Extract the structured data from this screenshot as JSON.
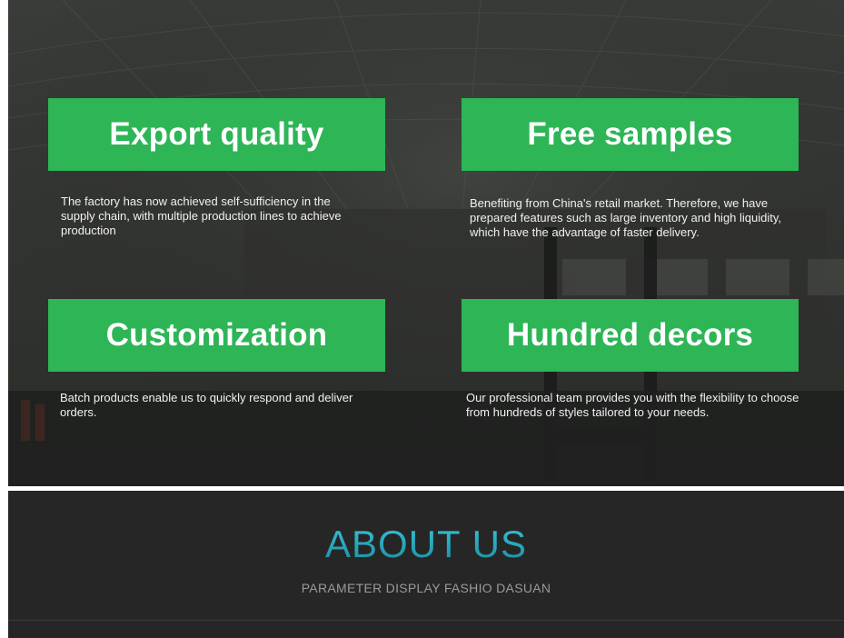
{
  "features": [
    {
      "title": "Export quality",
      "description": "The factory has now achieved self-sufficiency in the supply chain, with multiple production lines to achieve production"
    },
    {
      "title": "Free samples",
      "description": "Benefiting from China's retail market. Therefore, we have prepared features such as large inventory and high liquidity, which have the advantage of faster delivery."
    },
    {
      "title": "Customization",
      "description": "Batch products enable us to quickly respond and deliver orders."
    },
    {
      "title": "Hundred decors",
      "description": "Our professional team provides you with the flexibility to choose from hundreds of styles tailored to your needs."
    }
  ],
  "about": {
    "title": "ABOUT US",
    "subtitle": "PARAMETER DISPLAY FASHIO DASUAN"
  },
  "colors": {
    "accent_green": "#2db556",
    "about_title_teal": "#29b3c6",
    "section_background": "#262626"
  }
}
